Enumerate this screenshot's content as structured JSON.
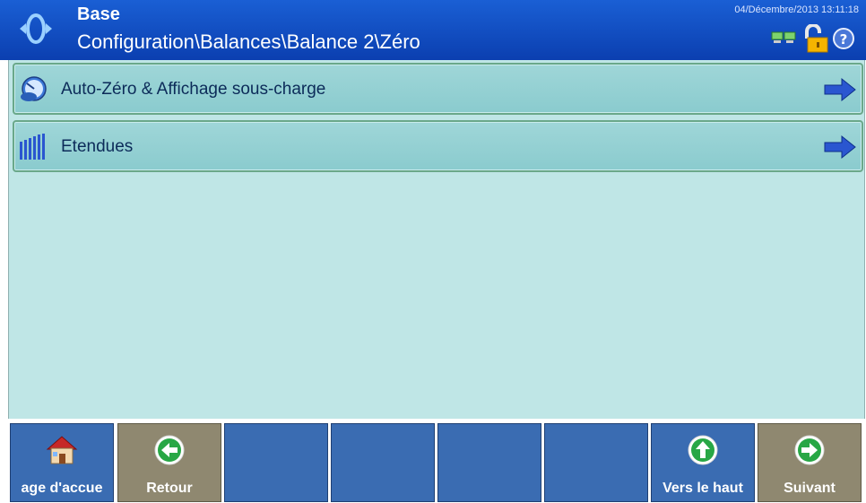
{
  "header": {
    "title": "Base",
    "path": "Configuration\\Balances\\Balance 2\\Zéro",
    "datetime": "04/Décembre/2013 13:11:18",
    "icons": [
      "network-icon",
      "lock-open-icon",
      "help-icon"
    ]
  },
  "menu": {
    "items": [
      {
        "label": "Auto-Zéro & Affichage sous-charge",
        "icon": "zero-gauge-icon"
      },
      {
        "label": "Etendues",
        "icon": "ranges-icon"
      }
    ]
  },
  "softkeys": [
    {
      "label": "age d'accue",
      "icon": "home-icon",
      "color": "#3a6cb2"
    },
    {
      "label": "Retour",
      "icon": "arrow-left-icon",
      "color": "#8f8870"
    },
    {
      "label": "",
      "icon": "",
      "color": "#3a6cb2"
    },
    {
      "label": "",
      "icon": "",
      "color": "#3a6cb2"
    },
    {
      "label": "",
      "icon": "",
      "color": "#3a6cb2"
    },
    {
      "label": "",
      "icon": "",
      "color": "#3a6cb2"
    },
    {
      "label": "Vers le haut",
      "icon": "arrow-up-icon",
      "color": "#3a6cb2"
    },
    {
      "label": "Suivant",
      "icon": "arrow-right-icon",
      "color": "#8f8870"
    }
  ]
}
